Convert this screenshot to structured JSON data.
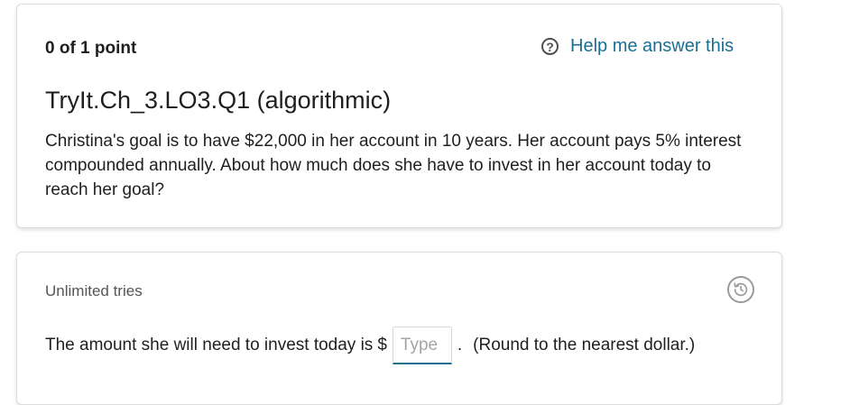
{
  "question_card": {
    "points": "0 of 1 point",
    "help_label": "Help me answer this",
    "help_icon": "question-circle-icon",
    "title": "TryIt.Ch_3.LO3.Q1 (algorithmic)",
    "text": "Christina's goal is to have $22,000 in her account in 10 years. Her account pays 5% interest compounded annually. About how much does she have to invest in her account today to reach her goal?"
  },
  "answer_card": {
    "tries": "Unlimited tries",
    "history_icon": "history-icon",
    "prompt": "The amount she will need to invest today is",
    "currency": "$",
    "input_value": "",
    "input_placeholder": "Type",
    "separator": ".",
    "note": "(Round to the nearest dollar.)"
  },
  "colors": {
    "link": "#1b6f92",
    "text": "#1f1f1f",
    "muted": "#555555",
    "border": "#dcdcdc"
  }
}
